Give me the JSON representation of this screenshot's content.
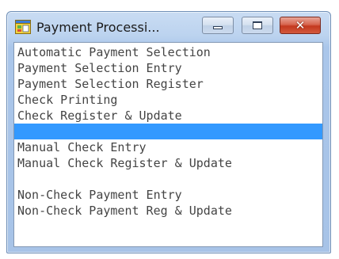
{
  "window": {
    "title": "Payment Processi...",
    "icon": "app-window-icon"
  },
  "caption_buttons": {
    "minimize_icon": "minimize-icon",
    "maximize_icon": "maximize-icon",
    "close_icon": "close-icon",
    "close_glyph": "✕"
  },
  "colors": {
    "selection": "#3399ff",
    "close_button": "#c4381f",
    "frame": "#aac6ea"
  },
  "menu": {
    "items": [
      {
        "label": "Automatic Payment Selection"
      },
      {
        "label": "Payment Selection Entry"
      },
      {
        "label": "Payment Selection Register"
      },
      {
        "label": "Check Printing"
      },
      {
        "label": "Check Register & Update"
      },
      {
        "label": ""
      },
      {
        "label": "Manual Check Entry"
      },
      {
        "label": "Manual Check Register & Update"
      },
      {
        "label": ""
      },
      {
        "label": "Non-Check Payment Entry"
      },
      {
        "label": "Non-Check Payment Reg & Update"
      }
    ],
    "selected_index": 5
  }
}
